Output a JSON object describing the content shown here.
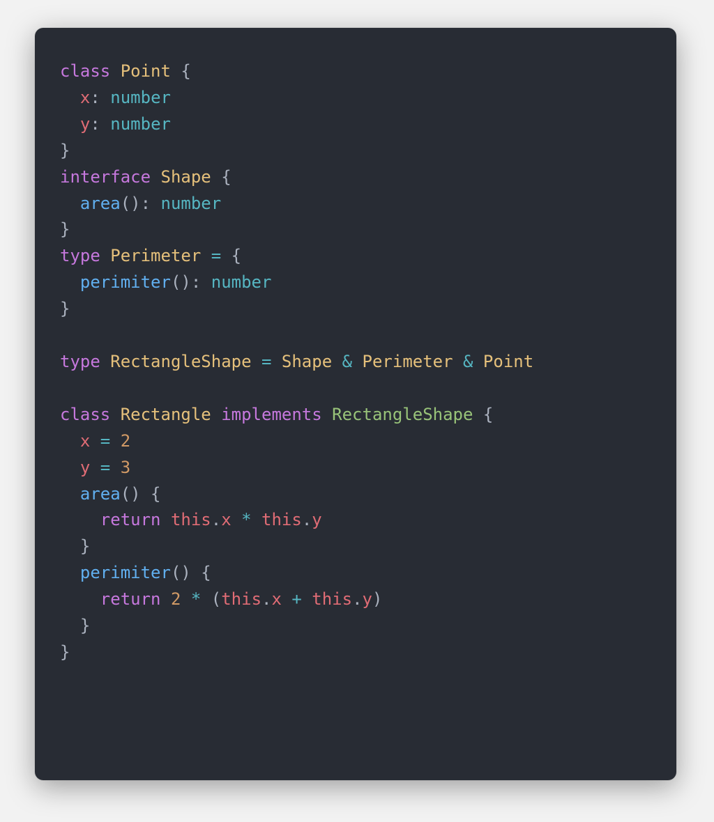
{
  "colors": {
    "background": "#f2f2f2",
    "card": "#282c34",
    "default": "#abb2bf",
    "keyword": "#c678dd",
    "classname": "#e5c07b",
    "type": "#56b6c2",
    "method": "#61afef",
    "typename": "#98c379",
    "this": "#e06c75",
    "number": "#d19a66"
  },
  "tokens": [
    [
      {
        "t": "class ",
        "c": "keyword"
      },
      {
        "t": "Point",
        "c": "classname"
      },
      {
        "t": " {",
        "c": "punct"
      }
    ],
    [
      {
        "t": "  x",
        "c": "prop"
      },
      {
        "t": ": ",
        "c": "punct"
      },
      {
        "t": "number",
        "c": "type"
      }
    ],
    [
      {
        "t": "  y",
        "c": "prop"
      },
      {
        "t": ": ",
        "c": "punct"
      },
      {
        "t": "number",
        "c": "type"
      }
    ],
    [
      {
        "t": "}",
        "c": "punct"
      }
    ],
    [
      {
        "t": "interface ",
        "c": "keyword"
      },
      {
        "t": "Shape",
        "c": "classname"
      },
      {
        "t": " {",
        "c": "punct"
      }
    ],
    [
      {
        "t": "  ",
        "c": "punct"
      },
      {
        "t": "area",
        "c": "method"
      },
      {
        "t": "(): ",
        "c": "punct"
      },
      {
        "t": "number",
        "c": "type"
      }
    ],
    [
      {
        "t": "}",
        "c": "punct"
      }
    ],
    [
      {
        "t": "type ",
        "c": "keyword"
      },
      {
        "t": "Perimeter",
        "c": "classname"
      },
      {
        "t": " ",
        "c": "punct"
      },
      {
        "t": "=",
        "c": "op"
      },
      {
        "t": " {",
        "c": "punct"
      }
    ],
    [
      {
        "t": "  ",
        "c": "punct"
      },
      {
        "t": "perimiter",
        "c": "method"
      },
      {
        "t": "(): ",
        "c": "punct"
      },
      {
        "t": "number",
        "c": "type"
      }
    ],
    [
      {
        "t": "}",
        "c": "punct"
      }
    ],
    [
      {
        "t": "",
        "c": "punct"
      }
    ],
    [
      {
        "t": "type ",
        "c": "keyword"
      },
      {
        "t": "RectangleShape",
        "c": "classname"
      },
      {
        "t": " ",
        "c": "punct"
      },
      {
        "t": "=",
        "c": "op"
      },
      {
        "t": " ",
        "c": "punct"
      },
      {
        "t": "Shape",
        "c": "classname"
      },
      {
        "t": " ",
        "c": "punct"
      },
      {
        "t": "&",
        "c": "op"
      },
      {
        "t": " ",
        "c": "punct"
      },
      {
        "t": "Perimeter",
        "c": "classname"
      },
      {
        "t": " ",
        "c": "punct"
      },
      {
        "t": "&",
        "c": "op"
      },
      {
        "t": " ",
        "c": "punct"
      },
      {
        "t": "Point",
        "c": "classname"
      }
    ],
    [
      {
        "t": "",
        "c": "punct"
      }
    ],
    [
      {
        "t": "class ",
        "c": "keyword"
      },
      {
        "t": "Rectangle",
        "c": "classname"
      },
      {
        "t": " ",
        "c": "punct"
      },
      {
        "t": "implements",
        "c": "keyword"
      },
      {
        "t": " ",
        "c": "punct"
      },
      {
        "t": "RectangleShape",
        "c": "typename"
      },
      {
        "t": " {",
        "c": "punct"
      }
    ],
    [
      {
        "t": "  x ",
        "c": "prop"
      },
      {
        "t": "=",
        "c": "op"
      },
      {
        "t": " ",
        "c": "punct"
      },
      {
        "t": "2",
        "c": "number"
      }
    ],
    [
      {
        "t": "  y ",
        "c": "prop"
      },
      {
        "t": "=",
        "c": "op"
      },
      {
        "t": " ",
        "c": "punct"
      },
      {
        "t": "3",
        "c": "number"
      }
    ],
    [
      {
        "t": "  ",
        "c": "punct"
      },
      {
        "t": "area",
        "c": "method"
      },
      {
        "t": "() {",
        "c": "punct"
      }
    ],
    [
      {
        "t": "    ",
        "c": "punct"
      },
      {
        "t": "return",
        "c": "keyword"
      },
      {
        "t": " ",
        "c": "punct"
      },
      {
        "t": "this",
        "c": "this"
      },
      {
        "t": ".",
        "c": "punct"
      },
      {
        "t": "x",
        "c": "prop"
      },
      {
        "t": " ",
        "c": "punct"
      },
      {
        "t": "*",
        "c": "op"
      },
      {
        "t": " ",
        "c": "punct"
      },
      {
        "t": "this",
        "c": "this"
      },
      {
        "t": ".",
        "c": "punct"
      },
      {
        "t": "y",
        "c": "prop"
      }
    ],
    [
      {
        "t": "  }",
        "c": "punct"
      }
    ],
    [
      {
        "t": "  ",
        "c": "punct"
      },
      {
        "t": "perimiter",
        "c": "method"
      },
      {
        "t": "() {",
        "c": "punct"
      }
    ],
    [
      {
        "t": "    ",
        "c": "punct"
      },
      {
        "t": "return",
        "c": "keyword"
      },
      {
        "t": " ",
        "c": "punct"
      },
      {
        "t": "2",
        "c": "number"
      },
      {
        "t": " ",
        "c": "punct"
      },
      {
        "t": "*",
        "c": "op"
      },
      {
        "t": " (",
        "c": "punct"
      },
      {
        "t": "this",
        "c": "this"
      },
      {
        "t": ".",
        "c": "punct"
      },
      {
        "t": "x",
        "c": "prop"
      },
      {
        "t": " ",
        "c": "punct"
      },
      {
        "t": "+",
        "c": "op"
      },
      {
        "t": " ",
        "c": "punct"
      },
      {
        "t": "this",
        "c": "this"
      },
      {
        "t": ".",
        "c": "punct"
      },
      {
        "t": "y",
        "c": "prop"
      },
      {
        "t": ")",
        "c": "punct"
      }
    ],
    [
      {
        "t": "  }",
        "c": "punct"
      }
    ],
    [
      {
        "t": "}",
        "c": "punct"
      }
    ]
  ]
}
